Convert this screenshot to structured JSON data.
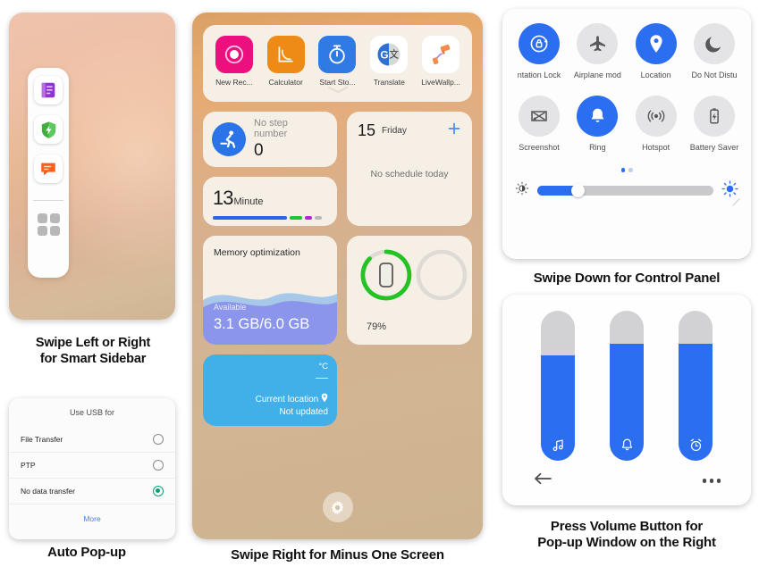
{
  "captions": {
    "sidebar": "Swipe Left or Right\nfor Smart Sidebar",
    "sidebar_line1": "Swipe Left or Right",
    "sidebar_line2": "for Smart Sidebar",
    "usb": "Auto Pop-up",
    "minusone": "Swipe Right for Minus One Screen",
    "control": "Swipe Down for Control Panel",
    "volume_line1": "Press Volume Button for",
    "volume_line2": "Pop-up Window on the Right"
  },
  "smart_sidebar": {
    "items": [
      {
        "name": "notes-app-icon",
        "color": "#a24ddb"
      },
      {
        "name": "security-shield-icon",
        "color": "#45b649"
      },
      {
        "name": "messages-app-icon",
        "color": "#f4631e"
      }
    ],
    "more_apps": "grid-icon"
  },
  "usb_dialog": {
    "title": "Use USB for",
    "options": [
      {
        "label": "File Transfer",
        "selected": false
      },
      {
        "label": "PTP",
        "selected": false
      },
      {
        "label": "No data transfer",
        "selected": true
      }
    ],
    "more_label": "More",
    "accent": "#109c74",
    "link_color": "#4383e8"
  },
  "minus_one_screen": {
    "apps": [
      {
        "label": "New Rec...",
        "icon": "record-icon",
        "bg": "#ec0f7d"
      },
      {
        "label": "Calculator",
        "icon": "calculator-icon",
        "bg": "#ed8b16"
      },
      {
        "label": "Start Sto...",
        "icon": "stopwatch-icon",
        "bg": "#2f7ae5"
      },
      {
        "label": "Translate",
        "icon": "translate-icon",
        "bg": "#ffffff"
      },
      {
        "label": "LiveWallp...",
        "icon": "paint-roller-icon",
        "bg": "#ffffff"
      }
    ],
    "steps": {
      "label": "No step\nnumber",
      "label_line1": "No step",
      "label_line2": "number",
      "value": "0",
      "icon": "running-person-icon"
    },
    "minute": {
      "value": "13",
      "unit": "Minute",
      "segments": [
        {
          "color": "#2c63e8",
          "width": 83
        },
        {
          "color": "#22c237",
          "width": 14
        },
        {
          "color": "#b026d6",
          "width": 8
        },
        {
          "color": "#b9b9b9",
          "width": 8
        }
      ]
    },
    "calendar": {
      "day": "15",
      "weekday": "Friday",
      "add_icon": "plus-icon",
      "empty_text": "No schedule today",
      "accent": "#4a8cf7"
    },
    "memory": {
      "title": "Memory optimization",
      "available_label": "Available",
      "value": "3.1 GB/6.0 GB",
      "fill_color": "#8b95ec"
    },
    "battery": {
      "percent": "79%",
      "ring_color": "#22c322",
      "icon": "phone-icon"
    },
    "weather": {
      "unit": "°C",
      "temp": "—",
      "location": "Current location",
      "location_icon": "location-pin-icon",
      "status": "Not updated",
      "bg": "#42b0e8"
    },
    "settings_icon": "gear-icon"
  },
  "control_panel": {
    "toggles": [
      {
        "label": "ntation Lock",
        "icon": "orientation-lock-icon",
        "on": true
      },
      {
        "label": "Airplane mod",
        "icon": "airplane-icon",
        "on": false
      },
      {
        "label": "Location",
        "icon": "location-pin-icon",
        "on": true
      },
      {
        "label": "Do Not Distu",
        "icon": "moon-icon",
        "on": false
      },
      {
        "label": "Screenshot",
        "icon": "screenshot-icon",
        "on": false
      },
      {
        "label": "Ring",
        "icon": "bell-icon",
        "on": true
      },
      {
        "label": "Hotspot",
        "icon": "hotspot-icon",
        "on": false
      },
      {
        "label": "Battery Saver",
        "icon": "battery-saver-icon",
        "on": false
      }
    ],
    "page_dots": {
      "count": 2,
      "active": 0
    },
    "brightness": {
      "value_percent": 23,
      "low_icon": "brightness-low-icon",
      "high_icon": "brightness-high-icon",
      "accent": "#2b6ef0"
    },
    "resize_handle": "resize-handle-icon"
  },
  "volume_panel": {
    "sliders": [
      {
        "icon": "music-note-icon",
        "name": "media-volume-slider",
        "value_percent": 70
      },
      {
        "icon": "bell-icon",
        "name": "ring-volume-slider",
        "value_percent": 78
      },
      {
        "icon": "alarm-clock-icon",
        "name": "alarm-volume-slider",
        "value_percent": 78
      }
    ],
    "back_icon": "back-arrow-icon",
    "more_icon": "more-dots-icon",
    "accent": "#2b6ef0"
  }
}
